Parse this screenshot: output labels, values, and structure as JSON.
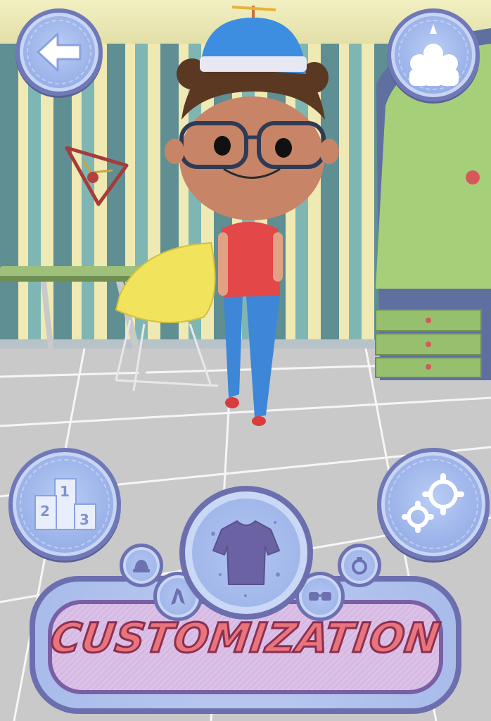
{
  "screen": {
    "title": "CUSTOMIZATION"
  },
  "buttons": {
    "back": {
      "icon": "back-arrow-icon"
    },
    "pets": {
      "icon": "pets-icon"
    },
    "leaderboard": {
      "icon": "podium-icon",
      "places": [
        "1",
        "2",
        "3"
      ]
    },
    "settings": {
      "icon": "gears-icon"
    },
    "customization": {
      "icon": "tshirt-icon"
    },
    "sub_icons": [
      "hat-icon",
      "hair-icon",
      "glasses-icon",
      "bow-icon"
    ]
  },
  "colors": {
    "button_fill": "#9db4ea",
    "button_border": "#6f79b8",
    "title_fill": "#e9747b",
    "title_stroke": "#8a2f52"
  }
}
